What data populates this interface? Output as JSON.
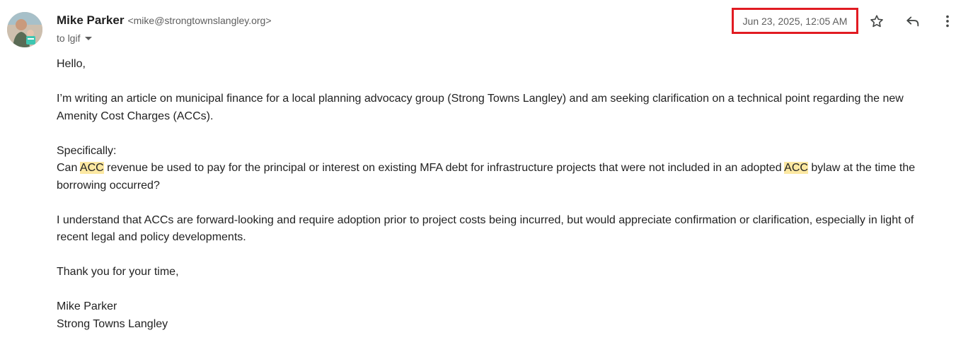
{
  "sender": {
    "name": "Mike Parker",
    "email": "<mike@strongtownslangley.org>"
  },
  "recipient": {
    "to_label": "to lgif"
  },
  "header": {
    "date": "Jun 23, 2025, 12:05 AM"
  },
  "icons": {
    "star": "star-icon",
    "reply": "reply-icon",
    "more": "more-vert-icon",
    "caret": "chevron-down-icon"
  },
  "colors": {
    "highlight": "#fce8a2",
    "date_box_border": "#e11b22"
  },
  "message": {
    "greeting": "Hello,",
    "para1": "I’m writing an article on municipal finance for a local planning advocacy group (Strong Towns Langley) and am seeking clarification on a technical point regarding the new Amenity Cost Charges (ACCs).",
    "specifically": "Specifically:",
    "q_part1": "Can ",
    "q_hl1": "ACC",
    "q_part2": " revenue be used to pay for the principal or interest on existing MFA debt for infrastructure projects that were not included in an adopted ",
    "q_hl2": "ACC",
    "q_part3": " bylaw at the time the borrowing occurred?",
    "para3": "I understand that ACCs are forward-looking and require adoption prior to project costs being incurred, but would appreciate confirmation or clarification, especially in light of recent legal and policy developments.",
    "thanks": "Thank you for your time,",
    "sig_name": "Mike Parker",
    "sig_org": "Strong Towns Langley"
  }
}
